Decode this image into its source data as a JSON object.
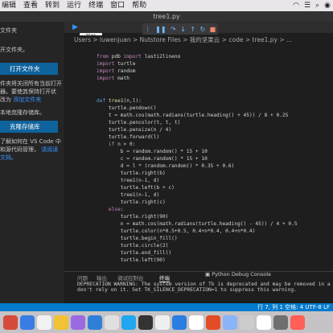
{
  "menubar": {
    "items": [
      "编辑",
      "查看",
      "转到",
      "运行",
      "终端",
      "窗口",
      "帮助"
    ]
  },
  "window": {
    "title": "tree1.py"
  },
  "sidebar": {
    "line1": "文件夹",
    "line2": "开文件夹。",
    "open_folder_button": "打开文件夹",
    "p1": "件夹将关闭所有当前打开",
    "p2": "器。要使其保持打开状",
    "p3_prefix": "改为",
    "p3_link": "添加文件夹",
    "p4": "本地克隆存储库。",
    "clone_button": "克隆存储库",
    "p5": "了解如何在 VS Code 中",
    "p6_prefix": "和源代码管理，",
    "p6_link": "请阅读",
    "p7": "文档。"
  },
  "tabs": {
    "tab1": "tre"
  },
  "tooltip": "开始",
  "breadcrumb": "Users  >  luwenjuan  >  Nutstore Files  >  我的坚果云  >  code  >  tree1.py  >  ...",
  "code": {
    "l1a": "from",
    "l1b": " pdb ",
    "l1c": "import",
    "l1d": " lasti2lineno",
    "l2a": "import",
    "l2b": " turtle",
    "l3a": "import",
    "l3b": " random",
    "l4a": "import",
    "l4b": " math",
    "l5a": "def",
    "l5b": " tree1",
    "l5c": "(n,l):",
    "l6": "    turtle.pendown()",
    "l7": "    t = math.cos(math.radians(turtle.heading() + 45)) / 8 + 0.25",
    "l8": "    turtle.pencolor(t, t, t)",
    "l9": "    turtle.pensize(n / 4)",
    "l10": "    turtle.forward(l)",
    "l11a": "    if",
    "l11b": " n > 0:",
    "l12": "        b = random.random() * 15 + 10",
    "l13": "        c = random.random() * 15 + 10",
    "l14": "        d = l * (random.random() * 0.35 + 0.6)",
    "l15": "        turtle.right(b)",
    "l16": "        tree1(n-1, d)",
    "l17": "        turtle.left(b + c)",
    "l18": "        tree1(n-1, d)",
    "l19": "        turtle.right(c)",
    "l20a": "    else",
    "l20b": ":",
    "l21": "        turtle.right(90)",
    "l22": "        n = math.cos(math.radians(turtle.heading() - 45)) / 4 + 0.5",
    "l23": "        turtle.color(n*0.5+0.5, 0.4+n*0.4, 0.4+n*0.4)",
    "l24": "        turtle.begin_fill()",
    "l25": "        turtle.circle(2)",
    "l26": "        turtle.end_fill()",
    "l27": "        turtle.left(90)"
  },
  "panel": {
    "tab_problems": "问题",
    "tab_output": "输出",
    "tab_debug_console": "调试控制台",
    "tab_terminal": "终端",
    "right_label": "Python Debug Console"
  },
  "terminal": {
    "line1": "DEPRECATION WARNING: The system version of Tk is deprecated and may be removed in a futu",
    "line2": "don't rely on it. Set TK_SILENCE_DEPRECATION=1 to suppress this warning."
  },
  "statusbar": {
    "right": "行 7, 列 1   空格: 4   UTF-8   LF"
  },
  "dock": {
    "colors": [
      "#d44b3b",
      "#3b7be4",
      "#f2f2f2",
      "#f1c232",
      "#9a6ae0",
      "#2f7fd8",
      "#e0e0e0",
      "#22a6f0",
      "#333333",
      "#f0f0f0",
      "#2a7de1",
      "#ffffff",
      "#e34c26",
      "#8ab4f8",
      "#cccccc",
      "#ffffff",
      "#6f6f6f",
      "#ff5f57"
    ]
  },
  "accent": "#007acc"
}
